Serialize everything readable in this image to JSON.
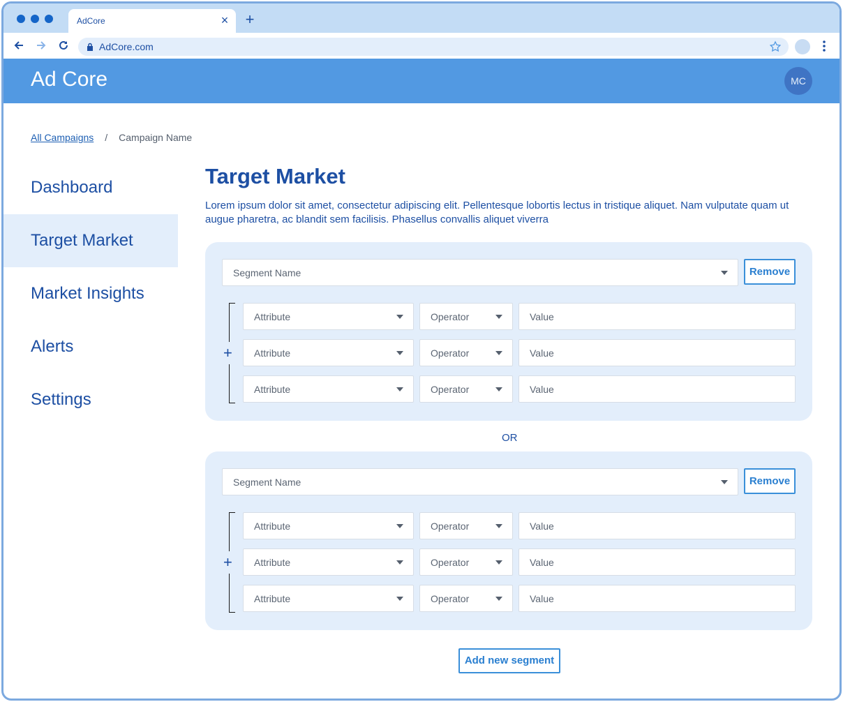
{
  "browser": {
    "tab_title": "AdCore",
    "url": "AdCore.com"
  },
  "app": {
    "brand": "Ad Core",
    "avatar_initials": "MC"
  },
  "breadcrumb": {
    "link": "All Campaigns",
    "separator": "/",
    "current": "Campaign Name"
  },
  "sidebar": {
    "items": [
      {
        "label": "Dashboard",
        "active": false
      },
      {
        "label": "Target Market",
        "active": true
      },
      {
        "label": "Market Insights",
        "active": false
      },
      {
        "label": "Alerts",
        "active": false
      },
      {
        "label": "Settings",
        "active": false
      }
    ]
  },
  "main": {
    "title": "Target Market",
    "description": "Lorem ipsum dolor sit amet, consectetur adipiscing elit. Pellentesque lobortis lectus in tristique aliquet. Nam vulputate quam ut augue pharetra, ac blandit sem facilisis. Phasellus convallis aliquet viverra",
    "or_label": "OR",
    "add_segment_label": "Add new segment",
    "segments": [
      {
        "name_placeholder": "Segment Name",
        "remove_label": "Remove",
        "rows": [
          {
            "attribute": "Attribute",
            "operator": "Operator",
            "value": "Value"
          },
          {
            "attribute": "Attribute",
            "operator": "Operator",
            "value": "Value"
          },
          {
            "attribute": "Attribute",
            "operator": "Operator",
            "value": "Value"
          }
        ]
      },
      {
        "name_placeholder": "Segment Name",
        "remove_label": "Remove",
        "rows": [
          {
            "attribute": "Attribute",
            "operator": "Operator",
            "value": "Value"
          },
          {
            "attribute": "Attribute",
            "operator": "Operator",
            "value": "Value"
          },
          {
            "attribute": "Attribute",
            "operator": "Operator",
            "value": "Value"
          }
        ]
      }
    ]
  },
  "colors": {
    "accent": "#5299e2",
    "primary_text": "#1d4fa3",
    "panel": "#e3eefb",
    "button_border": "#3a8fd9"
  }
}
